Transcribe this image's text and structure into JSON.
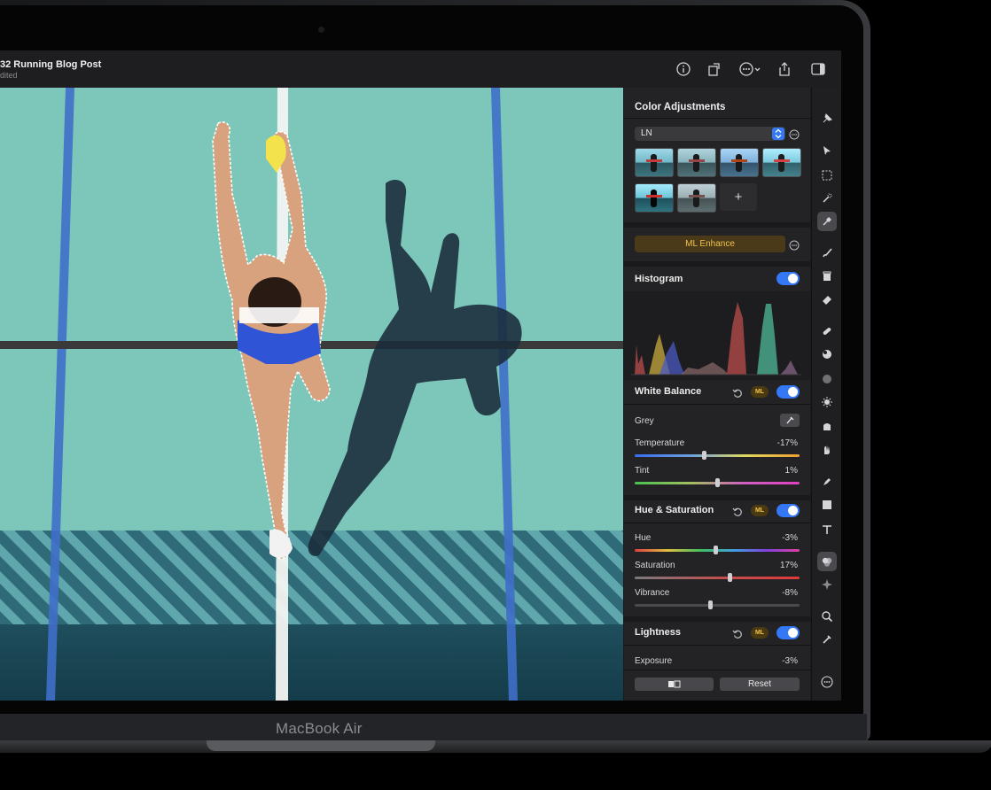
{
  "device": {
    "brand_label": "MacBook Air"
  },
  "titlebar": {
    "title": "32 Running Blog Post",
    "subtitle": "dited",
    "icons": [
      "info-icon",
      "rotate-icon",
      "more-icon",
      "share-icon",
      "sidebar-icon"
    ]
  },
  "inspector": {
    "title": "Color Adjustments",
    "preset_select": {
      "value": "LN"
    },
    "add_preset_label": "+",
    "ml_enhance_label": "ML Enhance",
    "histogram": {
      "title": "Histogram",
      "enabled": true
    },
    "white_balance": {
      "title": "White Balance",
      "ml_badge": "ML",
      "enabled": true,
      "grey_label": "Grey",
      "sliders": [
        {
          "label": "Temperature",
          "value": "-17%",
          "position": 0.42
        },
        {
          "label": "Tint",
          "value": "1%",
          "position": 0.5
        }
      ]
    },
    "hue_saturation": {
      "title": "Hue & Saturation",
      "ml_badge": "ML",
      "enabled": true,
      "sliders": [
        {
          "label": "Hue",
          "value": "-3%",
          "position": 0.49
        },
        {
          "label": "Saturation",
          "value": "17%",
          "position": 0.58
        },
        {
          "label": "Vibrance",
          "value": "-8%",
          "position": 0.46
        }
      ]
    },
    "lightness": {
      "title": "Lightness",
      "ml_badge": "ML",
      "enabled": true,
      "sliders": [
        {
          "label": "Exposure",
          "value": "-3%"
        }
      ]
    },
    "footer": {
      "compare_icon": "split-compare-icon",
      "reset_label": "Reset"
    }
  },
  "tools": [
    "pin-icon",
    "arrow-select-icon",
    "marquee-select-icon",
    "magic-select-icon",
    "ml-select-icon",
    "brush-icon",
    "bucket-icon",
    "eraser-icon",
    "bandage-icon",
    "clone-icon",
    "blur-icon",
    "sun-icon",
    "sponge-icon",
    "smudge-icon",
    "pen-icon",
    "shape-icon",
    "text-icon",
    "color-adjust-icon",
    "effects-icon",
    "zoom-icon",
    "eyedropper-icon",
    "more-tools-icon"
  ]
}
